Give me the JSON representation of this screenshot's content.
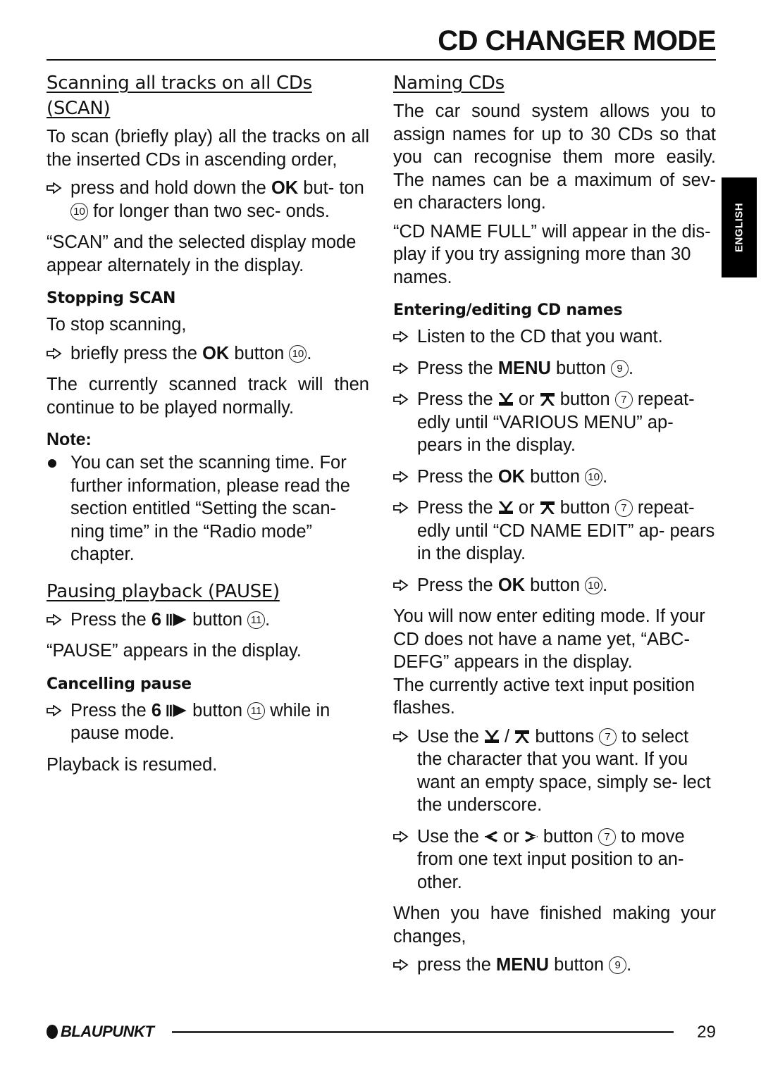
{
  "header": {
    "title": "CD CHANGER MODE"
  },
  "side_tab": {
    "label": "ENGLISH"
  },
  "left": {
    "scan": {
      "heading_line1": "Scanning all tracks on all CDs",
      "heading_line2": "(SCAN)",
      "intro": "To scan (briefly play) all the tracks on all the inserted CDs in ascending order,",
      "step1_a": "press and hold down the ",
      "step1_bold": "OK",
      "step1_b": " but- ton ",
      "step1_num": "10",
      "step1_c": " for longer than two sec- onds.",
      "after": "“SCAN” and the selected display mode appear alternately in the display."
    },
    "stop": {
      "heading": "Stopping SCAN",
      "intro": "To stop scanning,",
      "step1_a": "briefly press the ",
      "step1_bold": "OK",
      "step1_b": " button ",
      "step1_num": "10",
      "step1_c": ".",
      "after": "The currently scanned track will then continue to be played normally."
    },
    "note": {
      "title": "Note:",
      "text": "You can set the scanning time. For further information, please read the section entitled “Setting the scan- ning time” in the “Radio mode” chapter."
    },
    "pause": {
      "heading": "Pausing playback (PAUSE)",
      "step1_a": "Press the ",
      "step1_bold": "6",
      "step1_b": " button ",
      "step1_num": "11",
      "step1_c": ".",
      "after": "“PAUSE” appears in the display."
    },
    "cancel": {
      "heading": "Cancelling pause",
      "step1_a": "Press the ",
      "step1_bold": "6",
      "step1_b": " button ",
      "step1_num": "11",
      "step1_c": " while in pause mode.",
      "after": "Playback is resumed."
    }
  },
  "right": {
    "naming": {
      "heading": "Naming CDs",
      "para1": "The car sound system allows you to assign names for up to 30 CDs so that you can recognise them more easily. The names can be a maximum of sev- en characters long.",
      "para2": "“CD NAME FULL” will appear in the dis- play if you try assigning more than 30 names."
    },
    "editing": {
      "heading": "Entering/editing CD names",
      "s1": "Listen to the CD that you want.",
      "s2_a": "Press the ",
      "s2_bold": "MENU",
      "s2_b": " button ",
      "s2_num": "9",
      "s2_c": ".",
      "s3_a": "Press the ",
      "s3_or": " or ",
      "s3_b": " button ",
      "s3_num": "7",
      "s3_c": " repeat- edly until “VARIOUS MENU” ap- pears in the display.",
      "s4_a": "Press the ",
      "s4_bold": "OK",
      "s4_b": " button ",
      "s4_num": "10",
      "s4_c": ".",
      "s5_a": "Press the ",
      "s5_or": " or ",
      "s5_b": " button ",
      "s5_num": "7",
      "s5_c": " repeat- edly until “CD NAME EDIT” ap- pears in the display.",
      "s6_a": "Press the ",
      "s6_bold": "OK",
      "s6_b": " button ",
      "s6_num": "10",
      "s6_c": ".",
      "para1": "You will now enter editing mode. If your CD does not have a name yet, “ABC- DEFG” appears in the display.",
      "para2": "The currently active text input position flashes.",
      "s7_a": "Use the ",
      "s7_sep": " / ",
      "s7_b": " buttons ",
      "s7_num": "7",
      "s7_c": " to select the character that you want. If you want an empty space, simply se- lect the underscore.",
      "s8_a": "Use the ",
      "s8_or": " or ",
      "s8_b": " button ",
      "s8_num": "7",
      "s8_c": " to move from one text input position to an- other.",
      "para3": "When you have finished making your changes,",
      "s9_a": "press the ",
      "s9_bold": "MENU",
      "s9_b": " button ",
      "s9_num": "9",
      "s9_c": "."
    }
  },
  "footer": {
    "brand": "BLAUPUNKT",
    "page_number": "29"
  }
}
